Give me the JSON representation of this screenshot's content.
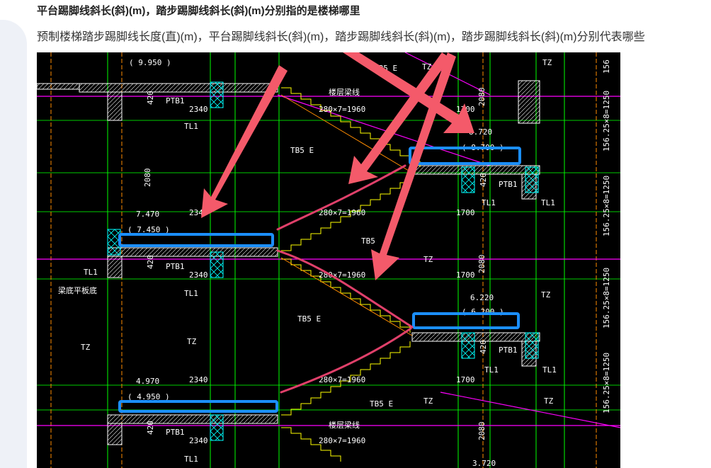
{
  "question": {
    "title": "平台踢脚线斜长(斜)(m)，踏步踢脚线斜长(斜)(m)分别指的是楼梯哪里",
    "description": "预制楼梯踏步踢脚线长度(直)(m)，平台踢脚线斜长(斜)(m)，踏步踢脚线斜长(斜)(m)，踏步踢脚线斜长(斜)(m)分别代表哪些"
  },
  "drawing": {
    "colors": {
      "background": "#000000",
      "wall": "#ffffff",
      "beam": "#00ff00",
      "stair": "#ffff00",
      "hatch": "#00ffff",
      "pink": "#ff00ff",
      "orange": "#ff8c00",
      "arrow": "#f45a6a",
      "highlight": "#1b8fff",
      "annotation": "#e0406a"
    },
    "labels": {
      "elev_top": "( 9.950 )",
      "elev_mid_right_top": "8.720",
      "elev_mid_right_paren": "( 8.700 )",
      "elev_left_mid": "7.470",
      "elev_left_mid_paren": "( 7.450 )",
      "elev_right_lower": "6.220",
      "elev_right_lower_paren": "( 6.200 )",
      "elev_left_low": "4.970",
      "elev_left_low_paren": "( 4.950 )",
      "elev_bottom": "3.720",
      "dim_2340": "2340",
      "dim_1700": "1700",
      "dim_2080": "2080",
      "dim_420": "420",
      "steps": "280×7=1960",
      "ptb1": "PTB1",
      "tl1": "TL1",
      "tz": "TZ",
      "tb5e": "TB5 E",
      "tb5": "TB5",
      "beam_note": "梁底平板底",
      "floor_beam": "楼层梁线",
      "side_dim": "156.25×8=1250",
      "side_top": "156"
    }
  }
}
